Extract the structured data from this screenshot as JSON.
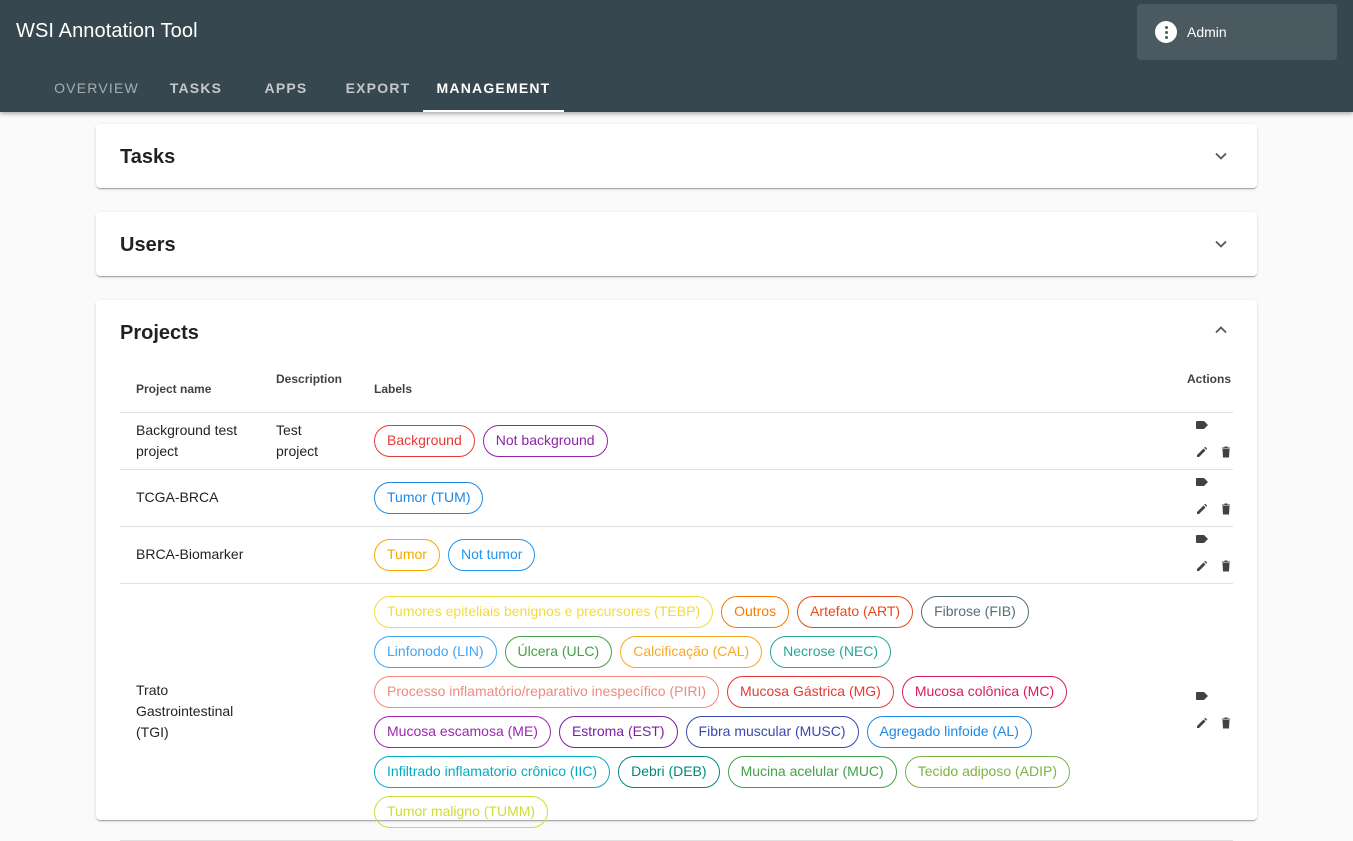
{
  "app": {
    "title": "WSI Annotation Tool",
    "user": "Admin"
  },
  "tabs": [
    "OVERVIEW",
    "TASKS",
    "APPS",
    "EXPORT",
    "MANAGEMENT"
  ],
  "panels": {
    "tasks": "Tasks",
    "users": "Users",
    "projects": "Projects"
  },
  "table": {
    "headers": {
      "name": "Project name",
      "description": "Description",
      "labels": "Labels",
      "actions": "Actions"
    },
    "rows": [
      {
        "name": "Background test project",
        "description": "Test project",
        "labels": [
          {
            "text": "Background",
            "color": "#e53935"
          },
          {
            "text": "Not background",
            "color": "#8e24aa"
          }
        ]
      },
      {
        "name": "TCGA-BRCA",
        "description": "",
        "labels": [
          {
            "text": "Tumor (TUM)",
            "color": "#1e88e5"
          }
        ]
      },
      {
        "name": "BRCA-Biomarker",
        "description": "",
        "labels": [
          {
            "text": "Tumor",
            "color": "#f4a900"
          },
          {
            "text": "Not tumor",
            "color": "#2196f3"
          }
        ]
      },
      {
        "name": "Trato Gastrointestinal (TGI)",
        "description": "",
        "labels": [
          {
            "text": "Tumores epiteliais benignos e precursores (TEBP)",
            "color": "#f2dc3a"
          },
          {
            "text": "Outros",
            "color": "#f57c00"
          },
          {
            "text": "Artefato (ART)",
            "color": "#e64a19"
          },
          {
            "text": "Fibrose (FIB)",
            "color": "#546e7a"
          },
          {
            "text": "Linfonodo (LIN)",
            "color": "#42a5f5"
          },
          {
            "text": "Úlcera (ULC)",
            "color": "#43a047"
          },
          {
            "text": "Calcificação (CAL)",
            "color": "#f9a825"
          },
          {
            "text": "Necrose (NEC)",
            "color": "#26a69a"
          },
          {
            "text": "Processo inflamatório/reparativo inespecífico (PIRI)",
            "color": "#ef8a7c"
          },
          {
            "text": "Mucosa Gástrica (MG)",
            "color": "#e53935"
          },
          {
            "text": "Mucosa colônica (MC)",
            "color": "#d81b60"
          },
          {
            "text": "Mucosa escamosa (ME)",
            "color": "#9c27b0"
          },
          {
            "text": "Estroma (EST)",
            "color": "#7b1fa2"
          },
          {
            "text": "Fibra muscular (MUSC)",
            "color": "#3949ab"
          },
          {
            "text": "Agregado linfoide (AL)",
            "color": "#1e88e5"
          },
          {
            "text": "Infiltrado inflamatorio crônico (IIC)",
            "color": "#00acc1"
          },
          {
            "text": "Debri (DEB)",
            "color": "#00897b"
          },
          {
            "text": "Mucina acelular (MUC)",
            "color": "#43a047"
          },
          {
            "text": "Tecido adiposo (ADIP)",
            "color": "#7cb342"
          },
          {
            "text": "Tumor maligno (TUMM)",
            "color": "#cddc39"
          }
        ]
      }
    ]
  },
  "icons": {
    "label": "label-icon",
    "edit": "edit-icon",
    "delete": "delete-icon",
    "expand": "chevron-down-icon",
    "collapse": "chevron-up-icon",
    "account": "account-icon"
  }
}
